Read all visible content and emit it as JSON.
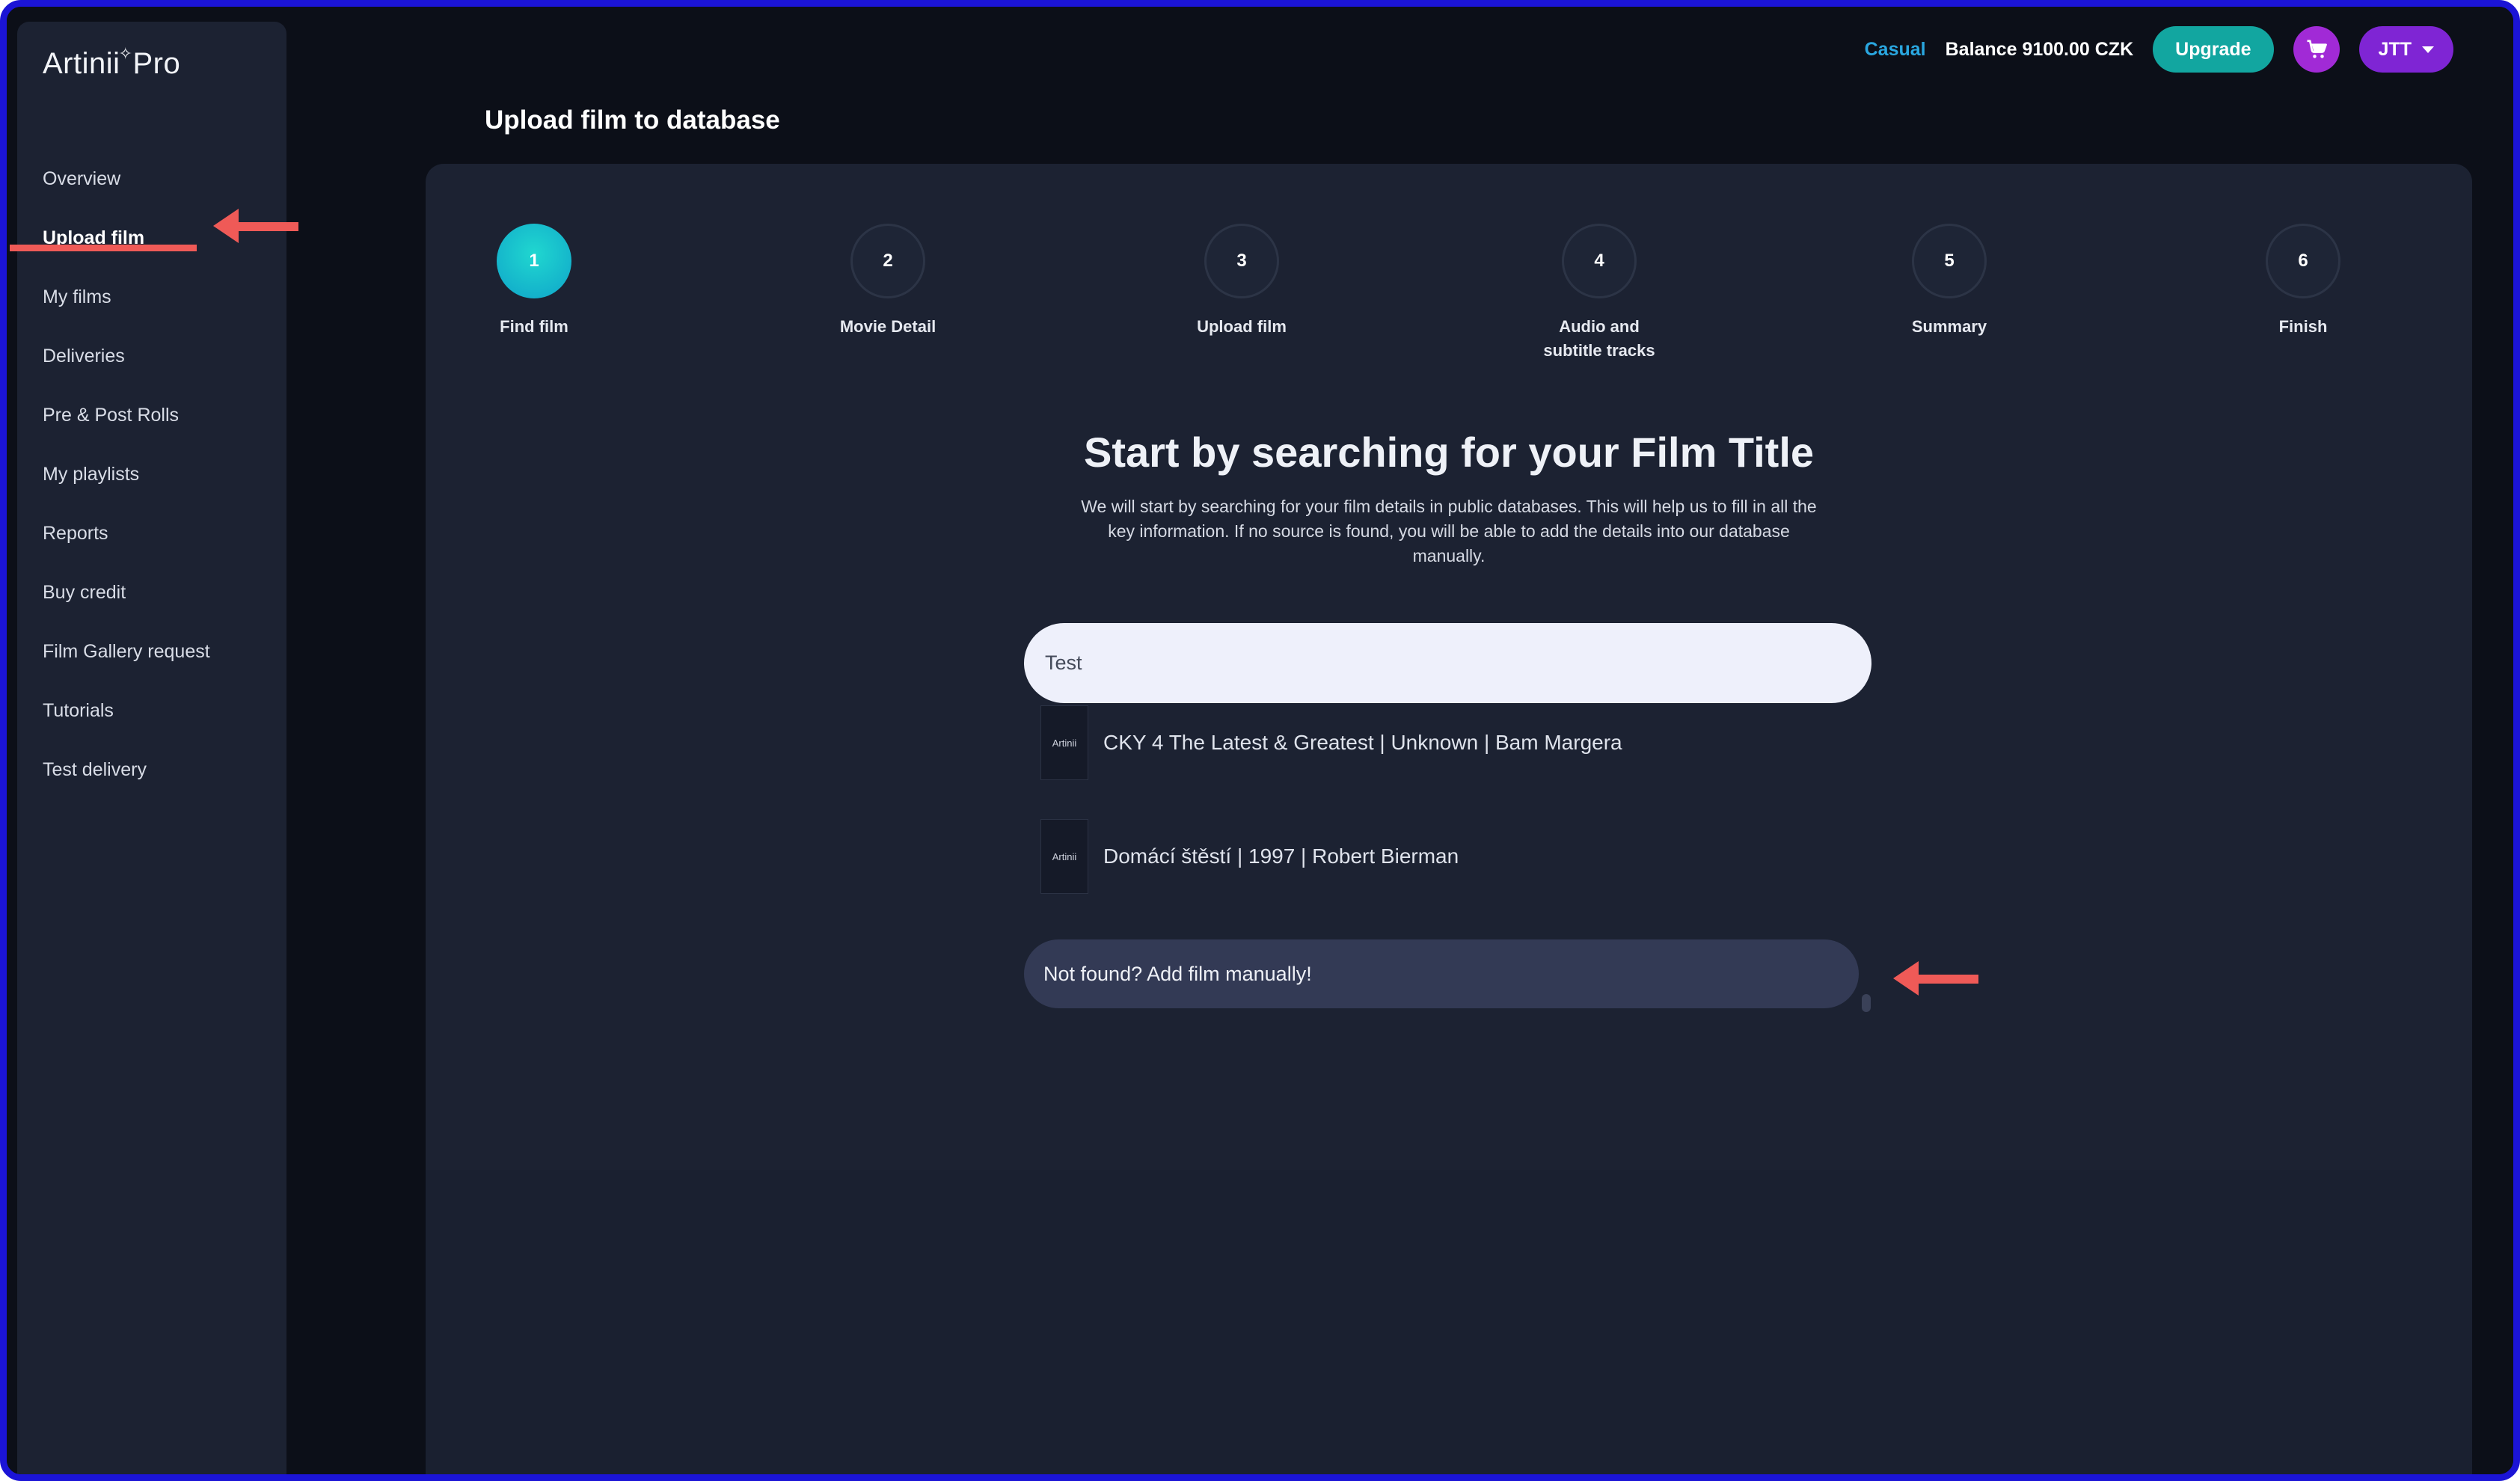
{
  "app": {
    "logo_text": "Artinii",
    "logo_suffix": "Pro"
  },
  "sidebar": {
    "items": [
      {
        "label": "Overview"
      },
      {
        "label": "Upload film"
      },
      {
        "label": "My films"
      },
      {
        "label": "Deliveries"
      },
      {
        "label": "Pre & Post Rolls"
      },
      {
        "label": "My playlists"
      },
      {
        "label": "Reports"
      },
      {
        "label": "Buy credit"
      },
      {
        "label": "Film Gallery request"
      },
      {
        "label": "Tutorials"
      },
      {
        "label": "Test delivery"
      }
    ],
    "active_index": 1
  },
  "topbar": {
    "plan": "Casual",
    "balance": "Balance 9100.00 CZK",
    "upgrade_label": "Upgrade",
    "cart_icon": "cart-icon",
    "user_label": "JTT"
  },
  "page": {
    "title": "Upload film to database"
  },
  "steps": [
    {
      "number": "1",
      "label": "Find film",
      "active": true
    },
    {
      "number": "2",
      "label": "Movie Detail",
      "active": false
    },
    {
      "number": "3",
      "label": "Upload film",
      "active": false
    },
    {
      "number": "4",
      "label": "Audio and subtitle tracks",
      "active": false
    },
    {
      "number": "5",
      "label": "Summary",
      "active": false
    },
    {
      "number": "6",
      "label": "Finish",
      "active": false
    }
  ],
  "hero": {
    "title": "Start by searching for your Film Title",
    "description": "We will start by searching for your film details in public databases. This will help us to fill in all the key information. If no source is found, you will be able to add the details into our database manually."
  },
  "search": {
    "value": "Test",
    "placeholder": ""
  },
  "results": [
    {
      "thumb_text": "Artinii",
      "text": "CKY 4 The Latest & Greatest | Unknown | Bam Margera"
    },
    {
      "thumb_text": "Artinii",
      "text": "Domácí štěstí | 1997 | Robert Bierman"
    }
  ],
  "not_found_label": "Not found? Add film manually!",
  "colors": {
    "background": "#0c0f18",
    "panel": "#1c2232",
    "accent_teal": "#12a6a0",
    "accent_purple": "#7f25d4",
    "annotation": "#ef5a57",
    "frame": "#1b14d6"
  }
}
